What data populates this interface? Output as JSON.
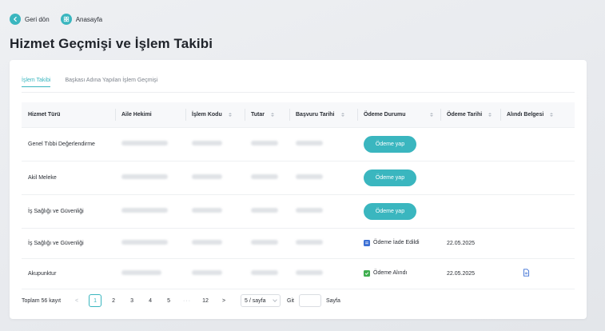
{
  "nav": {
    "back_label": "Geri dön",
    "home_label": "Anasayfa"
  },
  "page": {
    "title": "Hizmet Geçmişi ve İşlem Takibi"
  },
  "tabs": [
    {
      "label": "İşlem Takibi",
      "active": true
    },
    {
      "label": "Başkası Adına Yapılan İşlem Geçmişi",
      "active": false
    }
  ],
  "table": {
    "headers": [
      "Hizmet Türü",
      "Aile Hekimi",
      "İşlem Kodu",
      "Tutar",
      "Başvuru Tarihi",
      "Ödeme Durumu",
      "Ödeme Tarihi",
      "Alındı Belgesi"
    ],
    "rows": [
      {
        "service": "Genel Tıbbi Değerlendirme",
        "action": "Ödeme yap",
        "status": "",
        "pay_date": "",
        "receipt": false
      },
      {
        "service": "Akil Meleke",
        "action": "Ödeme yap",
        "status": "",
        "pay_date": "",
        "receipt": false
      },
      {
        "service": "İş Sağlığı ve Güvenliği",
        "action": "Ödeme yap",
        "status": "",
        "pay_date": "",
        "receipt": false
      },
      {
        "service": "İş Sağlığı ve Güvenliği",
        "action": "",
        "status": "Ödeme İade Edildi",
        "pay_date": "22.05.2025",
        "receipt": false
      },
      {
        "service": "Akupunktur",
        "action": "",
        "status": "Ödeme Alındı",
        "pay_date": "22.05.2025",
        "receipt": true
      }
    ]
  },
  "pagination": {
    "total": "Toplam 56 kayıt",
    "pages": [
      "1",
      "2",
      "3",
      "4",
      "5",
      "12"
    ],
    "current": "1",
    "dots": "···",
    "prev": "<",
    "next": ">",
    "page_size": "5 / sayfa",
    "goto_label": "Git",
    "page_suffix": "Sayfa"
  },
  "colors": {
    "accent": "#3ab6bf",
    "refund": "#3b6fd4",
    "received": "#3fae4f"
  },
  "icons": {
    "back": "back-arrow-icon",
    "home": "home-grid-icon",
    "refund": "refund-status-icon",
    "received": "check-status-icon",
    "receipt": "document-icon"
  }
}
